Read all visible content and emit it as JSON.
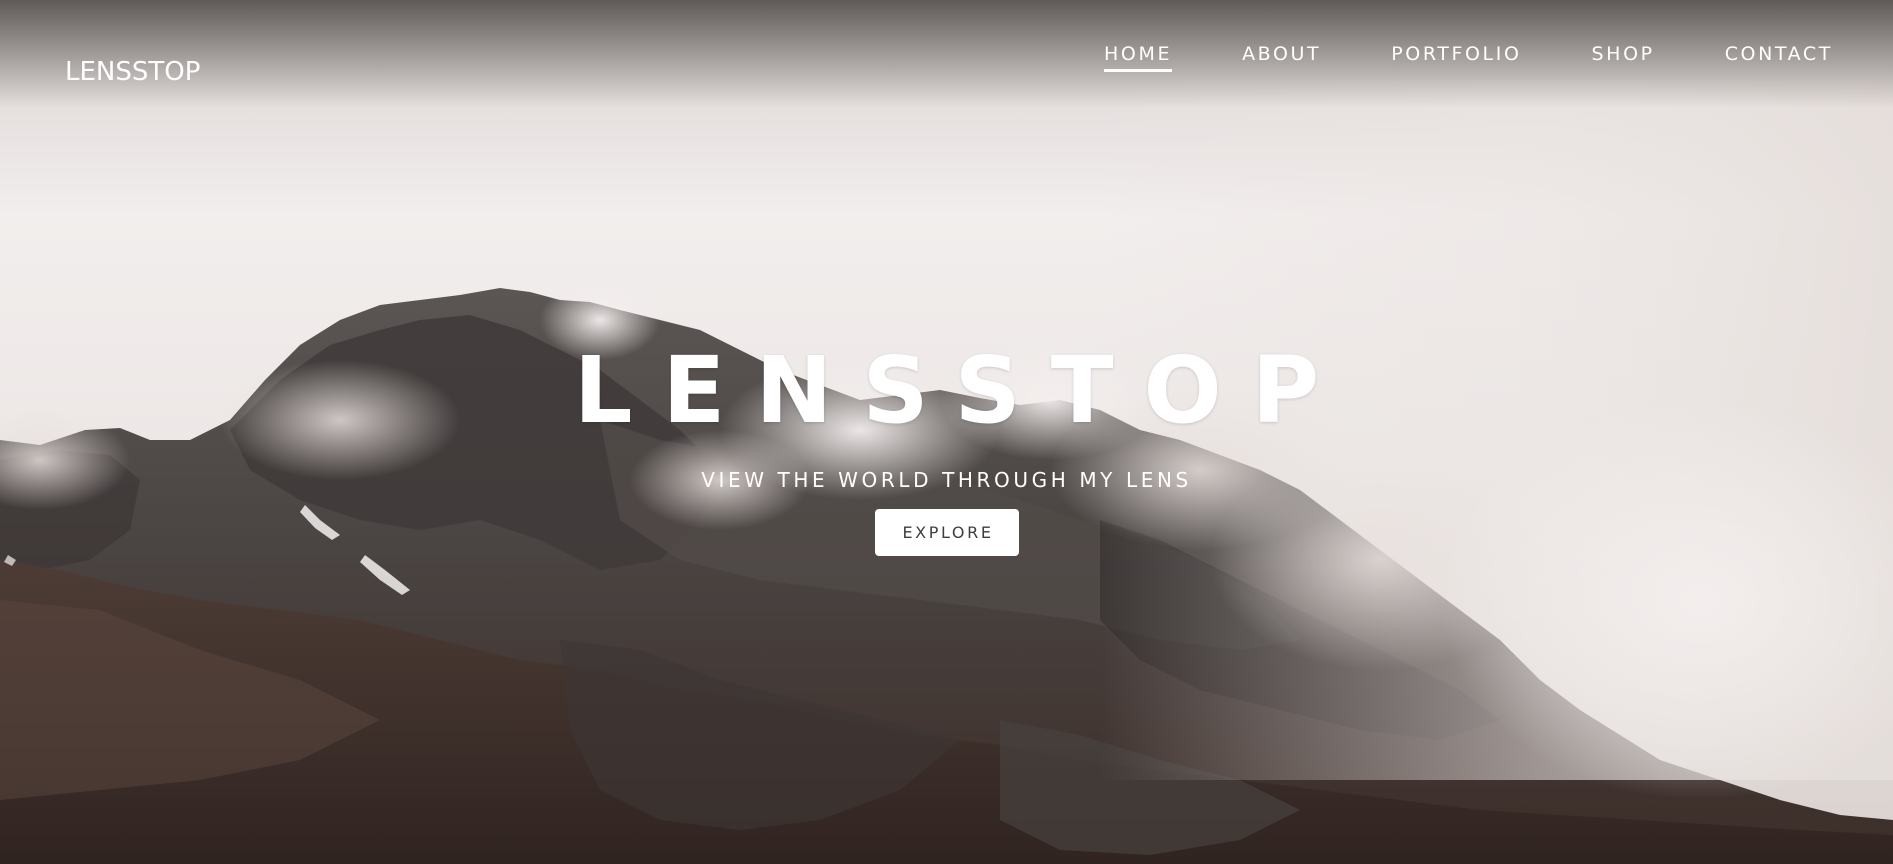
{
  "header": {
    "logo": "LENSSTOP",
    "nav": [
      {
        "label": "HOME",
        "active": true
      },
      {
        "label": "ABOUT",
        "active": false
      },
      {
        "label": "PORTFOLIO",
        "active": false
      },
      {
        "label": "SHOP",
        "active": false
      },
      {
        "label": "CONTACT",
        "active": false
      }
    ]
  },
  "hero": {
    "title": "LENSSTOP",
    "subtitle": "VIEW THE WORLD THROUGH MY LENS",
    "button_label": "EXPLORE",
    "background": "misty rocky mountain photo"
  },
  "colors": {
    "text": "#ffffff",
    "button_bg": "#ffffff",
    "button_text": "#3d3d3d",
    "sky": "#e9e4e2",
    "rock": "#4f4a48",
    "earth": "#4a3a33"
  }
}
